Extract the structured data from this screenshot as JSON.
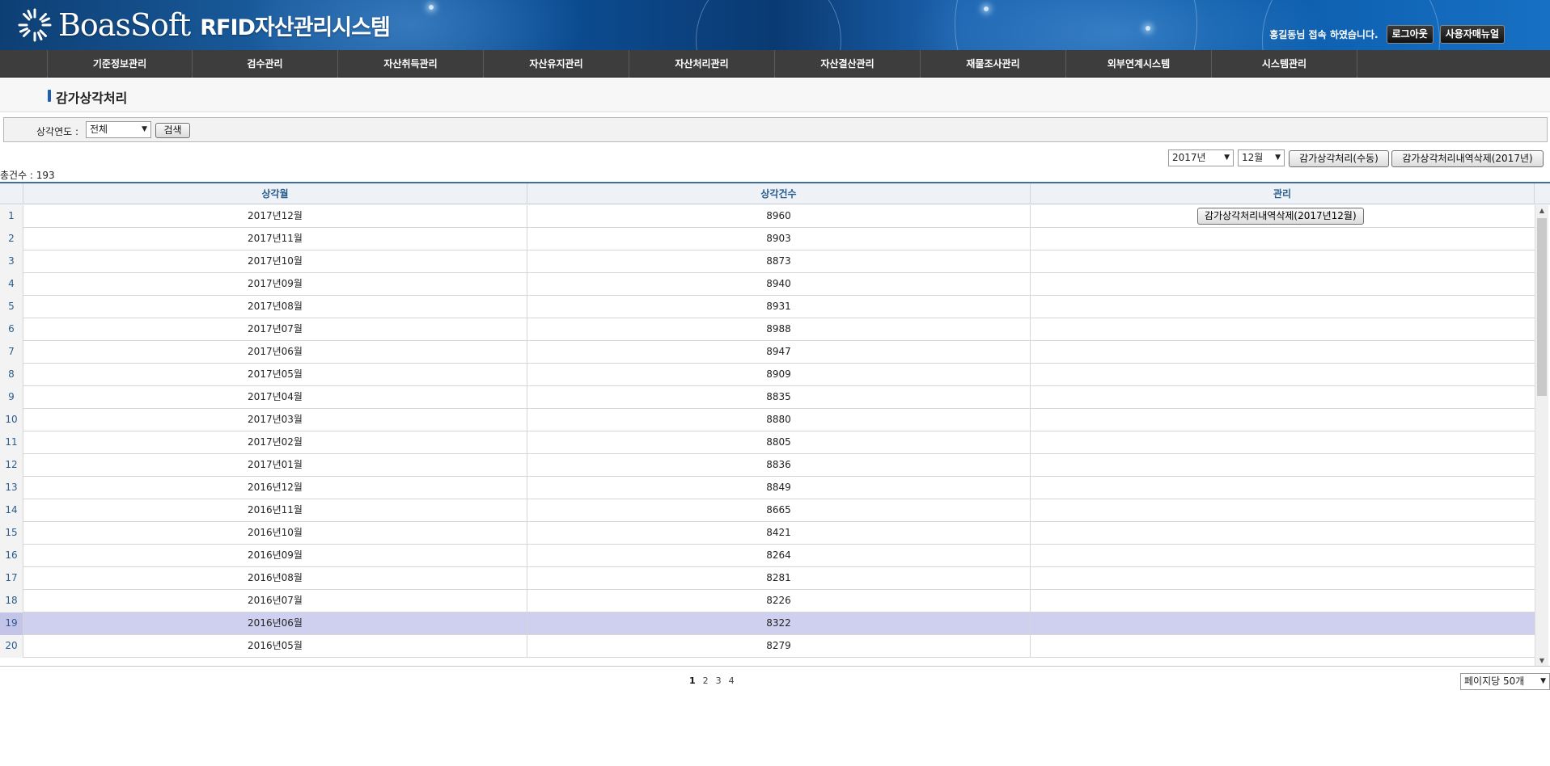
{
  "header": {
    "brand": "BoasSoft",
    "system_name": "RFID자산관리시스템",
    "welcome": "홍길동님 접속 하였습니다.",
    "logout_label": "로그아웃",
    "manual_label": "사용자매뉴얼"
  },
  "nav": {
    "items": [
      {
        "label": "기준정보관리"
      },
      {
        "label": "검수관리"
      },
      {
        "label": "자산취득관리"
      },
      {
        "label": "자산유지관리"
      },
      {
        "label": "자산처리관리"
      },
      {
        "label": "자산결산관리"
      },
      {
        "label": "재물조사관리"
      },
      {
        "label": "외부연계시스템"
      },
      {
        "label": "시스템관리"
      }
    ]
  },
  "page": {
    "title": "감가상각처리"
  },
  "search": {
    "year_label": "상각연도 :",
    "year_value": "전체",
    "search_button": "검색"
  },
  "actions": {
    "year_value": "2017년",
    "month_value": "12월",
    "manual_process_button": "감가상각처리(수동)",
    "delete_year_button": "감가상각처리내역삭제(2017년)"
  },
  "total": {
    "text": "총건수 : 193"
  },
  "table": {
    "columns": [
      "상각월",
      "상각건수",
      "관리"
    ],
    "row_action_label": "감가상각처리내역삭제(2017년12월)",
    "rows": [
      {
        "no": "1",
        "month": "2017년12월",
        "count": "8960"
      },
      {
        "no": "2",
        "month": "2017년11월",
        "count": "8903"
      },
      {
        "no": "3",
        "month": "2017년10월",
        "count": "8873"
      },
      {
        "no": "4",
        "month": "2017년09월",
        "count": "8940"
      },
      {
        "no": "5",
        "month": "2017년08월",
        "count": "8931"
      },
      {
        "no": "6",
        "month": "2017년07월",
        "count": "8988"
      },
      {
        "no": "7",
        "month": "2017년06월",
        "count": "8947"
      },
      {
        "no": "8",
        "month": "2017년05월",
        "count": "8909"
      },
      {
        "no": "9",
        "month": "2017년04월",
        "count": "8835"
      },
      {
        "no": "10",
        "month": "2017년03월",
        "count": "8880"
      },
      {
        "no": "11",
        "month": "2017년02월",
        "count": "8805"
      },
      {
        "no": "12",
        "month": "2017년01월",
        "count": "8836"
      },
      {
        "no": "13",
        "month": "2016년12월",
        "count": "8849"
      },
      {
        "no": "14",
        "month": "2016년11월",
        "count": "8665"
      },
      {
        "no": "15",
        "month": "2016년10월",
        "count": "8421"
      },
      {
        "no": "16",
        "month": "2016년09월",
        "count": "8264"
      },
      {
        "no": "17",
        "month": "2016년08월",
        "count": "8281"
      },
      {
        "no": "18",
        "month": "2016년07월",
        "count": "8226"
      },
      {
        "no": "19",
        "month": "2016년06월",
        "count": "8322"
      },
      {
        "no": "20",
        "month": "2016년05월",
        "count": "8279"
      }
    ],
    "selected_row": 19
  },
  "pager": {
    "pages": [
      "1",
      "2",
      "3",
      "4"
    ],
    "current": "1",
    "page_size_value": "페이지당 50개"
  }
}
